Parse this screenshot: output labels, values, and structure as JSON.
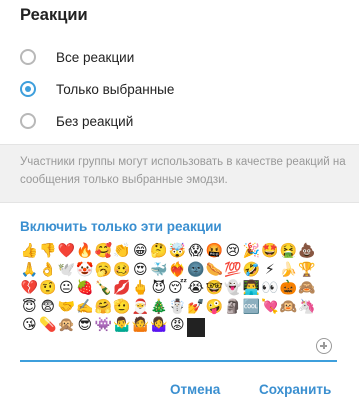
{
  "dialog": {
    "title": "Реакции"
  },
  "options": [
    {
      "label": "Все реакции",
      "checked": false
    },
    {
      "label": "Только выбранные",
      "checked": true
    },
    {
      "label": "Без реакций",
      "checked": false
    }
  ],
  "info": {
    "text": "Участники группы могут использовать в качестве реакций на сообщения только выбранные эмодзи."
  },
  "section": {
    "heading": "Включить только эти реакции"
  },
  "emojis": [
    "👍",
    "👎",
    "❤️",
    "🔥",
    "🥰",
    "👏",
    "😁",
    "🤔",
    "🤯",
    "😱",
    "🤬",
    "😢",
    "🎉",
    "🤩",
    "🤮",
    "💩",
    "🙏",
    "👌",
    "🕊️",
    "🤡",
    "🥱",
    "🥴",
    "😍",
    "🐳",
    "❤️‍🔥",
    "🌚",
    "🌭",
    "💯",
    "🤣",
    "⚡",
    "🍌",
    "🏆",
    "💔",
    "🤨",
    "😐",
    "🍓",
    "🍾",
    "💋",
    "🖕",
    "😈",
    "😴",
    "😭",
    "🤓",
    "👻",
    "👨‍💻",
    "👀",
    "🎃",
    "🙈",
    "😇",
    "😨",
    "🤝",
    "✍️",
    "🤗",
    "🫡",
    "🎅",
    "🎄",
    "☃️",
    "💅",
    "🤪",
    "🗿",
    "🆒",
    "💘",
    "🙉",
    "🦄",
    "😘",
    "💊",
    "🙊",
    "😎",
    "👾",
    "🤷‍♂️",
    "🤷",
    "🤷‍♀️",
    "😡"
  ],
  "buttons": {
    "cancel": "Отмена",
    "save": "Сохранить"
  },
  "colors": {
    "accent": "#3e9fdc",
    "link": "#3a8fd0",
    "info_bg": "#f1f1f1",
    "info_text": "#999999"
  },
  "icons": {
    "add": "add-circle-icon"
  }
}
